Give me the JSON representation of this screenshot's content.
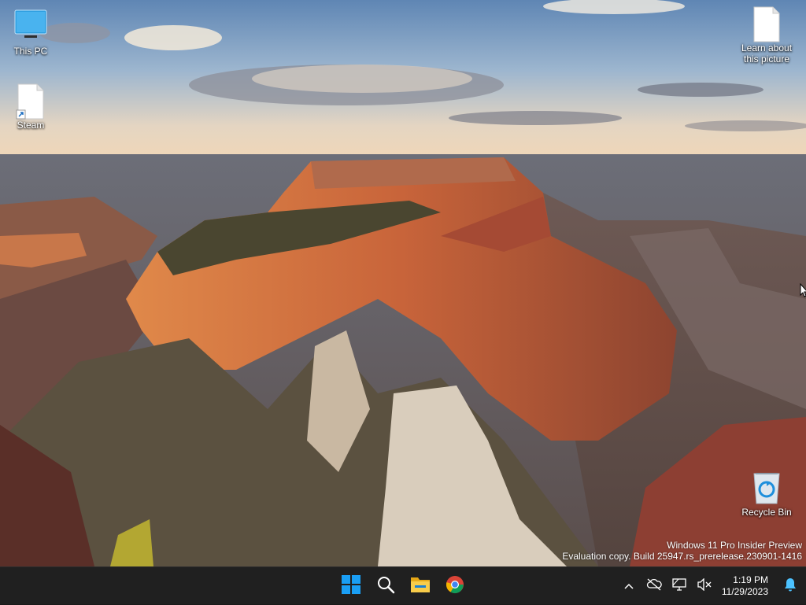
{
  "desktop": {
    "icons": [
      {
        "label": "This PC",
        "icon": "this-pc-icon"
      },
      {
        "label": "Steam",
        "icon": "steam-shortcut-icon"
      },
      {
        "label": "Learn about this picture",
        "icon": "document-icon"
      },
      {
        "label": "Recycle Bin",
        "icon": "recycle-bin-icon"
      }
    ],
    "watermark": {
      "line1": "Windows 11 Pro Insider Preview",
      "line2": "Evaluation copy. Build 25947.rs_prerelease.230901-1416"
    }
  },
  "taskbar": {
    "apps": [
      {
        "name": "Start",
        "icon": "windows-start-icon",
        "color": "#1a9ff5"
      },
      {
        "name": "Search",
        "icon": "search-icon",
        "color": "#ffffff"
      },
      {
        "name": "File Explorer",
        "icon": "folder-icon",
        "color": "#f4c542"
      },
      {
        "name": "Google Chrome",
        "icon": "chrome-icon",
        "color": "#db4437"
      }
    ],
    "tray": {
      "icons": [
        "chevron-up-icon",
        "onedrive-offline-icon",
        "network-icon",
        "volume-muted-icon",
        "notification-bell-icon"
      ],
      "time": "1:19 PM",
      "date": "11/29/2023",
      "accent": "#4cc2ff"
    }
  }
}
